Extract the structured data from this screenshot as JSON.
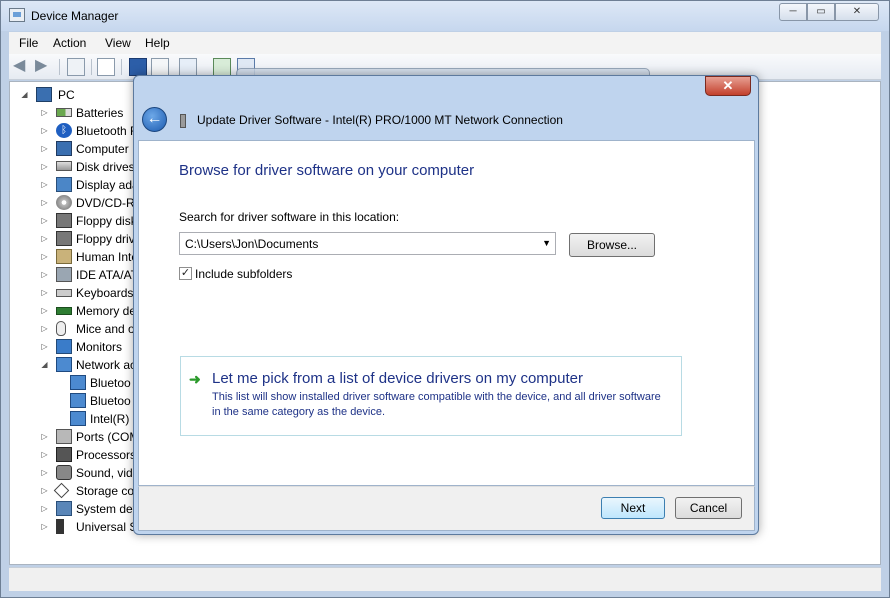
{
  "device_manager": {
    "title": "Device Manager",
    "caption": {
      "minimize": "─",
      "maximize": "▭",
      "close": "✕"
    },
    "menu": [
      "File",
      "Action",
      "View",
      "Help"
    ],
    "tree": {
      "root": "PC",
      "items": [
        {
          "label": "Batteries",
          "icon": "battery-icon",
          "expanded": false
        },
        {
          "label": "Bluetooth R",
          "icon": "bluetooth-icon",
          "expanded": false
        },
        {
          "label": "Computer",
          "icon": "computer-icon",
          "expanded": false
        },
        {
          "label": "Disk drives",
          "icon": "disk-drive-icon",
          "expanded": false
        },
        {
          "label": "Display ada",
          "icon": "display-adapter-icon",
          "expanded": false
        },
        {
          "label": "DVD/CD-RO",
          "icon": "dvd-drive-icon",
          "expanded": false
        },
        {
          "label": "Floppy disk",
          "icon": "floppy-disk-icon",
          "expanded": false
        },
        {
          "label": "Floppy driv",
          "icon": "floppy-drive-icon",
          "expanded": false
        },
        {
          "label": "Human Inte",
          "icon": "hid-icon",
          "expanded": false
        },
        {
          "label": "IDE ATA/AT",
          "icon": "ide-controller-icon",
          "expanded": false
        },
        {
          "label": "Keyboards",
          "icon": "keyboard-icon",
          "expanded": false
        },
        {
          "label": "Memory de",
          "icon": "memory-icon",
          "expanded": false
        },
        {
          "label": "Mice and o",
          "icon": "mouse-icon",
          "expanded": false
        },
        {
          "label": "Monitors",
          "icon": "monitor-icon",
          "expanded": false
        },
        {
          "label": "Network ac",
          "icon": "network-adapter-icon",
          "expanded": true
        },
        {
          "label": "Bluetoo",
          "icon": "network-adapter-icon",
          "child": true
        },
        {
          "label": "Bluetoo",
          "icon": "network-adapter-icon",
          "child": true
        },
        {
          "label": "Intel(R)",
          "icon": "network-adapter-icon",
          "child": true
        },
        {
          "label": "Ports (COM",
          "icon": "ports-icon",
          "expanded": false
        },
        {
          "label": "Processors",
          "icon": "processor-icon",
          "expanded": false
        },
        {
          "label": "Sound, vide",
          "icon": "sound-icon",
          "expanded": false
        },
        {
          "label": "Storage cor",
          "icon": "storage-controller-icon",
          "expanded": false
        },
        {
          "label": "System dev",
          "icon": "system-device-icon",
          "expanded": false
        },
        {
          "label": "Universal S",
          "icon": "usb-icon",
          "expanded": false
        }
      ]
    }
  },
  "update_driver": {
    "close": "✕",
    "back": "←",
    "title": "Update Driver Software - Intel(R) PRO/1000 MT Network Connection",
    "heading": "Browse for driver software on your computer",
    "search_label": "Search for driver software in this location:",
    "path_value": "C:\\Users\\Jon\\Documents",
    "browse": "Browse...",
    "include_subfolders": "Include subfolders",
    "include_subfolders_checked": true,
    "option_title": "Let me pick from a list of device drivers on my computer",
    "option_desc": "This list will show installed driver software compatible with the device, and all driver software in the same category as the device.",
    "next": "Next",
    "cancel": "Cancel"
  },
  "colors": {
    "heading": "#1e3287",
    "option_arrow": "#2c9a2c",
    "close_button": "#c2402c"
  }
}
